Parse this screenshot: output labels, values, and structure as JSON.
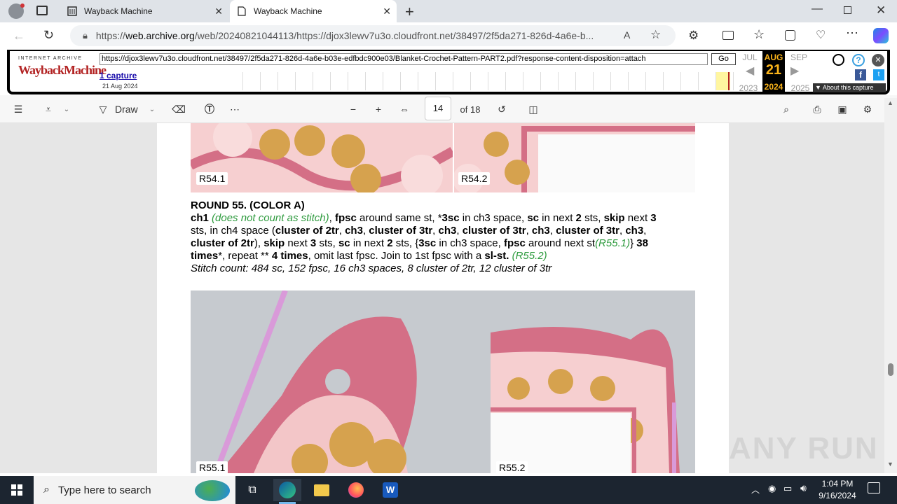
{
  "browser": {
    "tabs": [
      {
        "title": "Wayback Machine",
        "active": false
      },
      {
        "title": "Wayback Machine",
        "active": true
      }
    ],
    "url_prefix": "https://",
    "url_host": "web.archive.org",
    "url_rest": "/web/20240821044113/https://djox3lewv7u3o.cloudfront.net/38497/2f5da271-826d-4a6e-b...",
    "new_tab": "+"
  },
  "wayback": {
    "logo_top": "INTERNET ARCHIVE",
    "logo_main": "WaybackMachine",
    "url_value": "https://djox3lewv7u3o.cloudfront.net/38497/2f5da271-826d-4a6e-b03e-edfbdc900e03/Blanket-Crochet-Pattern-PART2.pdf?response-content-disposition=attach",
    "go_label": "Go",
    "captures": "1 capture",
    "capture_date": "21 Aug 2024",
    "prev_month": "JUL",
    "cur_month": "AUG",
    "next_month": "SEP",
    "day": "21",
    "prev_year": "2023",
    "cur_year": "2024",
    "next_year": "2025",
    "about": "About this capture"
  },
  "pdf_toolbar": {
    "draw_label": "Draw",
    "page_value": "14",
    "page_total": "of 18"
  },
  "pdf": {
    "label_r54_1": "R54.1",
    "label_r54_2": "R54.2",
    "heading": "ROUND 55. (COLOR A)",
    "line1": {
      "a": "ch1",
      "b": "(does not count as stitch)",
      "c": ",",
      "d": "fpsc",
      "e": "around same st, *",
      "f": "3sc",
      "g": "in ch3 space,",
      "h": "sc",
      "i": "in next",
      "j": "2",
      "k": "sts,",
      "l": "skip",
      "m": "next",
      "n": "3"
    },
    "line2": {
      "a": "sts, in ch4 space (",
      "b": "cluster of 2tr",
      "c": ",",
      "d": "ch3",
      "e": ",",
      "f": "cluster of 3tr",
      "g": ",",
      "h": "ch3",
      "i": ",",
      "j": "cluster of 3tr",
      "k": ",",
      "l": "ch3",
      "m": ",",
      "n": "cluster of 3tr",
      "o": ",",
      "p": "ch3",
      "q": ","
    },
    "line3": {
      "a": "cluster of 2tr",
      "b": "),",
      "c": "skip",
      "d": "next",
      "e": "3",
      "f": "sts,",
      "g": "sc",
      "h": "in next",
      "i": "2",
      "j": "sts, {",
      "k": "3sc",
      "l": "in ch3 space,",
      "m": "fpsc",
      "n": "around next st",
      "o": "(R55.1)",
      "p": "}",
      "q": "38"
    },
    "line4": {
      "a": "times",
      "b": "*, repeat **",
      "c": "4 times",
      "d": ", omit last fpsc. Join to 1st fpsc with a",
      "e": "sl-st.",
      "f": "(R55.2)"
    },
    "stitch_count": "Stitch count: 484 sc, 152 fpsc, 16 ch3 spaces, 8 cluster of 2tr, 12 cluster of 3tr",
    "label_r55_1": "R55.1",
    "label_r55_2": "R55.2"
  },
  "watermark": "ANY RUN",
  "taskbar": {
    "search_placeholder": "Type here to search",
    "time": "1:04 PM",
    "date": "9/16/2024"
  },
  "colors": {
    "wayback_red": "#b22222",
    "green_note": "#2e9b3e",
    "taskbar": "#1c2530",
    "yarn_pink": "#d46f86",
    "yarn_light_pink": "#f3c6c8",
    "yarn_mustard": "#d6a24e"
  }
}
